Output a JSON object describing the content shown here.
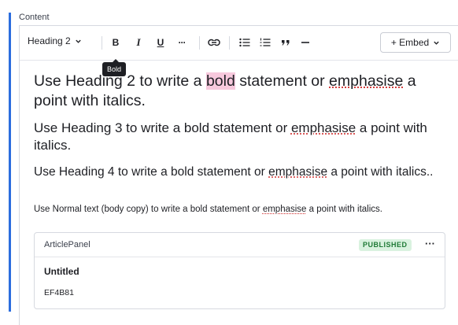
{
  "field": {
    "label": "Content"
  },
  "toolbar": {
    "block_type": "Heading 2",
    "bold_label": "B",
    "italic_label": "I",
    "underline_label": "U",
    "more_label": "···",
    "embed_label": "+ Embed"
  },
  "tooltip": {
    "text": "Bold"
  },
  "content": {
    "h2": {
      "before_bold": "Use Heading 2 to write a ",
      "bold": "bold",
      "middle": " statement or ",
      "emphasise": "emphasise",
      "after": " a point with italics."
    },
    "h3": {
      "before": "Use Heading 3 to write a bold statement or ",
      "emphasise": "emphasise",
      "after": " a point with italics."
    },
    "h4": {
      "before": "Use Heading 4 to write a bold statement or ",
      "emphasise": "emphasise",
      "after": " a point with italics.."
    },
    "normal": {
      "before": "Use Normal text (body copy) to write a bold statement or ",
      "emphasise": "emphasise",
      "after": " a point with italics."
    }
  },
  "panel": {
    "type": "ArticlePanel",
    "status": "PUBLISHED",
    "more": "···",
    "title": "Untitled",
    "id": "EF4B81"
  },
  "colors": {
    "accent": "#2b6dde",
    "highlight": "#f7c9dd",
    "badge_bg": "#d9f2df",
    "badge_text": "#1f7a36"
  }
}
